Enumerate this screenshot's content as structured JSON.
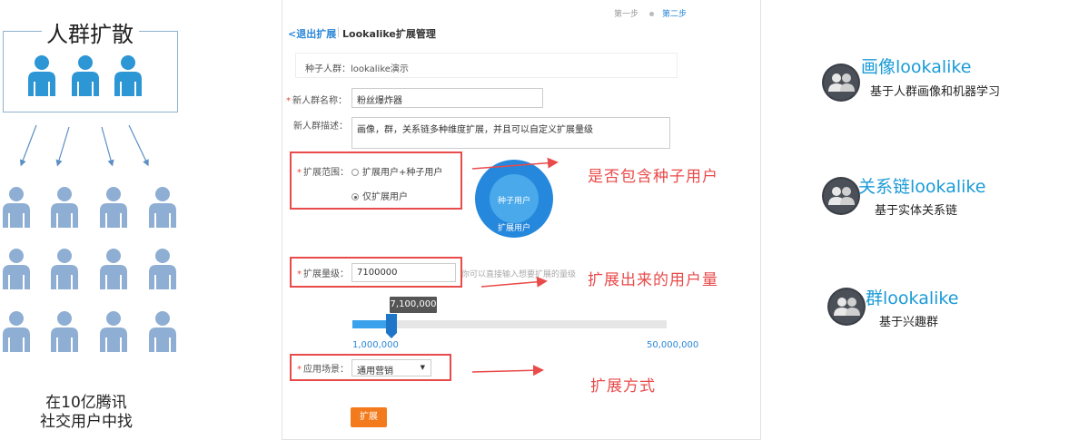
{
  "left": {
    "title": "人群扩散",
    "caption_line1": "在10亿腾讯",
    "caption_line2": "社交用户中找",
    "person_color": "#2d96d4",
    "crowd_color": "#8eaed3"
  },
  "panel": {
    "steps": {
      "step1": "第一步",
      "step2": "第二步"
    },
    "back_link": "<退出扩展",
    "title": "Lookalike扩展管理",
    "seed_crowd": "种子人群：lookalike演示",
    "name_field": {
      "label": "新人群名称：",
      "value": "粉丝爆炸器"
    },
    "desc_field": {
      "label": "新人群描述：",
      "value": "画像，群，关系链多种维度扩展，并且可以自定义扩展量级"
    },
    "range": {
      "label": "扩展范围：",
      "option1": "扩展用户+种子用户",
      "option2": "仅扩展用户",
      "selected": "仅扩展用户"
    },
    "donut": {
      "inner_label": "种子用户",
      "outer_label": "扩展用户",
      "inner_color": "#49a9eb",
      "outer_color": "#2688dc"
    },
    "volume": {
      "label": "扩展量级：",
      "value": "7100000",
      "hint": "你可以直接输入想要扩展的量级",
      "tooltip": "7,100,000",
      "min_label": "1,000,000",
      "max_label": "50,000,000",
      "min": 1000000,
      "max": 50000000,
      "current": 7100000
    },
    "scene": {
      "label": "应用场景：",
      "selected": "通用营销"
    },
    "expand_button": "扩展"
  },
  "annotations": {
    "range": "是否包含种子用户",
    "volume": "扩展出来的用户量",
    "scene": "扩展方式",
    "color": "#e94a4a"
  },
  "features": [
    {
      "title": "画像lookalike",
      "desc": "基于人群画像和机器学习"
    },
    {
      "title": "关系链lookalike",
      "desc": "基于实体关系链"
    },
    {
      "title": "群lookalike",
      "desc": "基于兴趣群"
    }
  ]
}
